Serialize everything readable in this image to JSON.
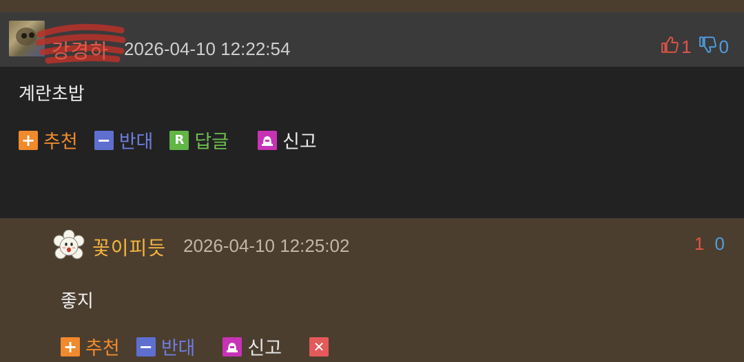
{
  "main_comment": {
    "author": "강경하",
    "timestamp": "2026-04-10 12:22:54",
    "upvotes": "1",
    "downvotes": "0",
    "body": "계란초밥",
    "actions": {
      "recommend": "추천",
      "oppose": "반대",
      "reply": "답글",
      "report": "신고"
    }
  },
  "reply_comment": {
    "author": "꽃이피듯",
    "timestamp": "2026-04-10 12:25:02",
    "upvotes": "1",
    "downvotes": "0",
    "body": "좋지",
    "actions": {
      "recommend": "추천",
      "oppose": "반대",
      "report": "신고"
    }
  },
  "icons": {
    "plus": "+",
    "minus": "−",
    "reply_badge": "R",
    "close": "✕"
  },
  "colors": {
    "recommend": "#f08a2c",
    "oppose": "#5e6fcf",
    "reply": "#61b646",
    "report": "#c733b5",
    "upvote": "#e25545",
    "downvote": "#4f9ee0",
    "author_main": "#e15a48",
    "author_reply": "#f5b441"
  }
}
